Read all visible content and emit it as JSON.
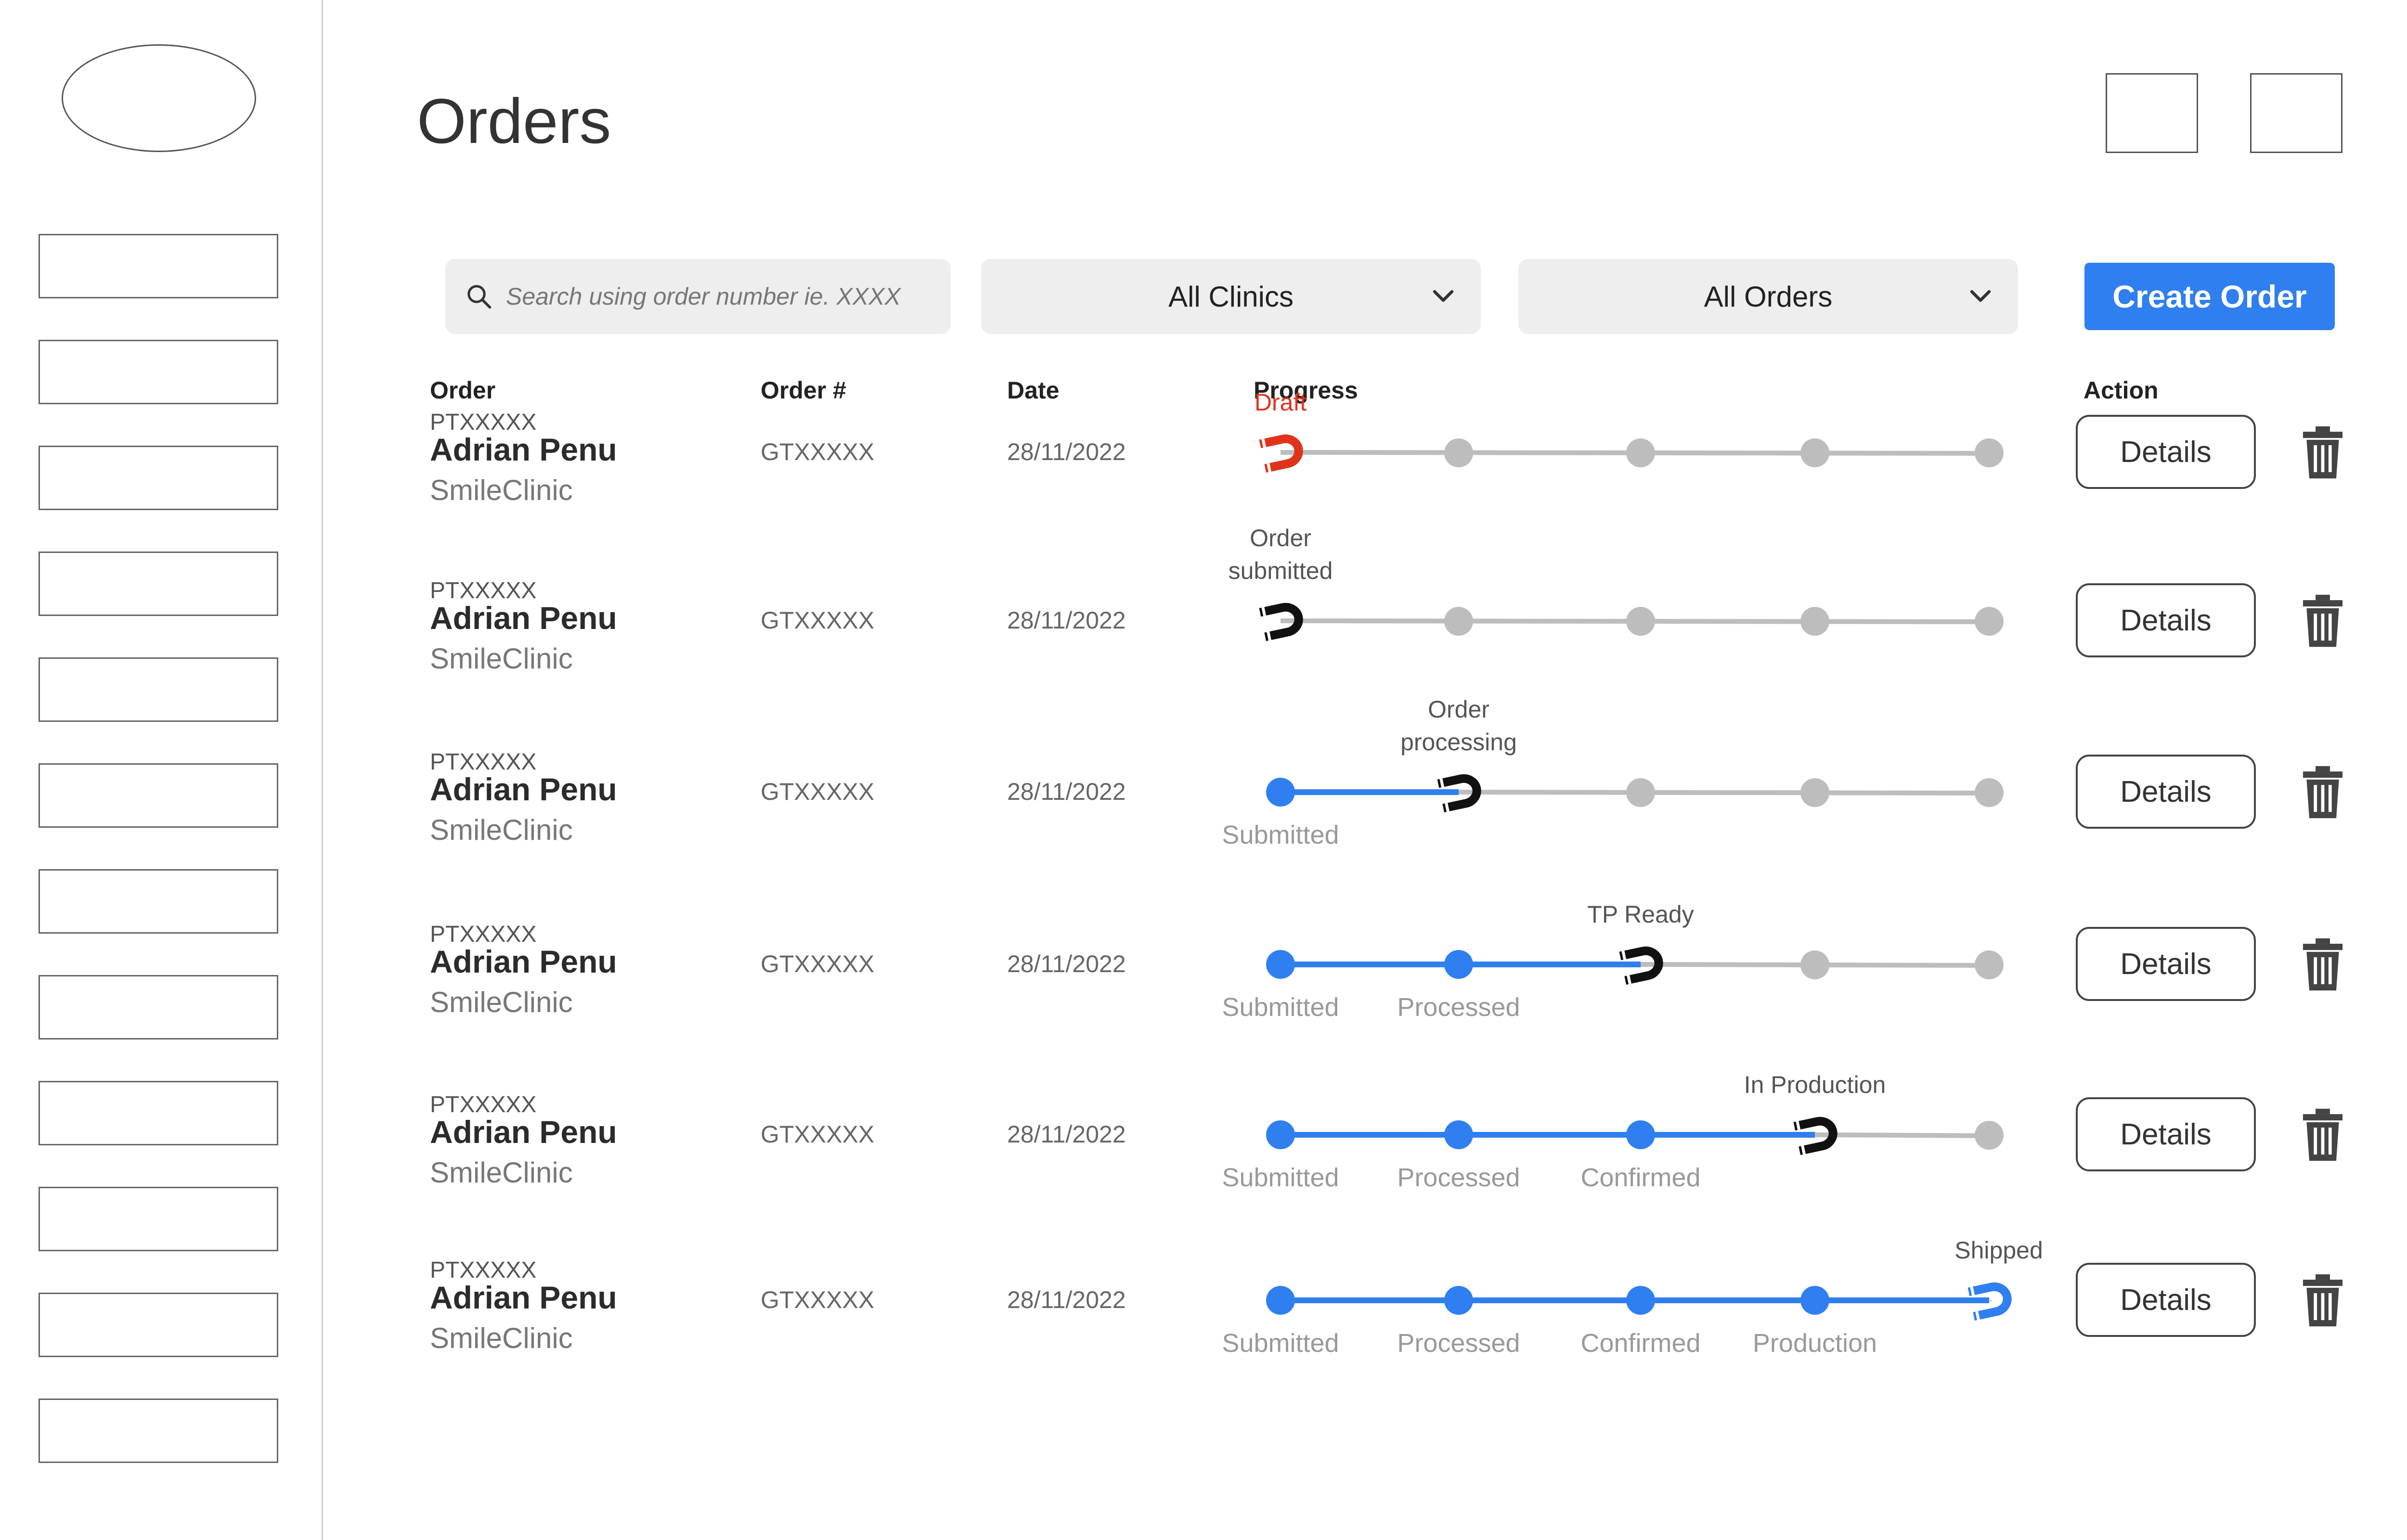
{
  "header": {
    "title": "Orders"
  },
  "filters": {
    "search_placeholder": "Search using order number ie. XXXX",
    "clinics_value": "All Clinics",
    "orders_value": "All Orders",
    "create_label": "Create Order"
  },
  "table": {
    "columns": [
      "Order",
      "Order #",
      "Date",
      "Progress",
      "Action"
    ]
  },
  "rows": [
    {
      "pt": "PTXXXXX",
      "name": "Adrian Penu",
      "clinic": "SmileClinic",
      "order_no": "GTXXXXX",
      "date": "28/11/2022",
      "stage": 0,
      "stage_label": "Draft",
      "completed": [],
      "action": "Details"
    },
    {
      "pt": "PTXXXXX",
      "name": "Adrian Penu",
      "clinic": "SmileClinic",
      "order_no": "GTXXXXX",
      "date": "28/11/2022",
      "stage": 0,
      "stage_label": "Order submitted",
      "completed": [],
      "action": "Details"
    },
    {
      "pt": "PTXXXXX",
      "name": "Adrian Penu",
      "clinic": "SmileClinic",
      "order_no": "GTXXXXX",
      "date": "28/11/2022",
      "stage": 1,
      "stage_label": "Order processing",
      "completed": [
        "Submitted"
      ],
      "action": "Details"
    },
    {
      "pt": "PTXXXXX",
      "name": "Adrian Penu",
      "clinic": "SmileClinic",
      "order_no": "GTXXXXX",
      "date": "28/11/2022",
      "stage": 2,
      "stage_label": "TP Ready",
      "completed": [
        "Submitted",
        "Processed"
      ],
      "action": "Details"
    },
    {
      "pt": "PTXXXXX",
      "name": "Adrian Penu",
      "clinic": "SmileClinic",
      "order_no": "GTXXXXX",
      "date": "28/11/2022",
      "stage": 3,
      "stage_label": "In Production",
      "completed": [
        "Submitted",
        "Processed",
        "Confirmed"
      ],
      "action": "Details"
    },
    {
      "pt": "PTXXXXX",
      "name": "Adrian Penu",
      "clinic": "SmileClinic",
      "order_no": "GTXXXXX",
      "date": "28/11/2022",
      "stage": 4,
      "stage_label": "Shipped",
      "completed": [
        "Submitted",
        "Processed",
        "Confirmed",
        "Production"
      ],
      "action": "Details"
    }
  ],
  "colors": {
    "accent": "#2f7ff0",
    "draft": "#e0331b",
    "pending_dot": "#bdbdbd",
    "current_marker": "#111111"
  }
}
